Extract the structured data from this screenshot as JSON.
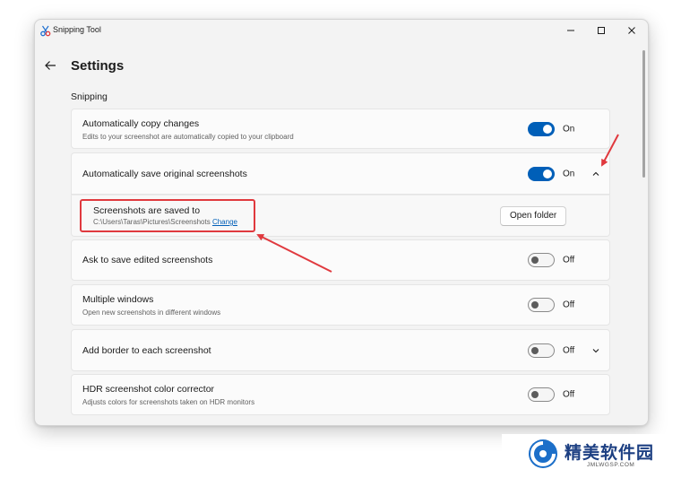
{
  "window": {
    "app_title": "Snipping Tool",
    "app_icon": "scissors-icon",
    "controls": {
      "minimize": "minimize-icon",
      "maximize": "maximize-icon",
      "close": "close-icon"
    }
  },
  "page": {
    "back_icon": "back-arrow-icon",
    "title": "Settings",
    "section": "Snipping"
  },
  "settings": {
    "auto_copy": {
      "title": "Automatically copy changes",
      "description": "Edits to your screenshot are automatically copied to your clipboard",
      "state": "On"
    },
    "auto_save": {
      "title": "Automatically save original screenshots",
      "state": "On",
      "expand_icon": "chevron-up-icon"
    },
    "save_location": {
      "title": "Screenshots are saved to",
      "path": "C:\\Users\\Taras\\Pictures\\Screenshots",
      "change_link": "Change",
      "button": "Open folder"
    },
    "ask_save": {
      "title": "Ask to save edited screenshots",
      "state": "Off"
    },
    "multi_window": {
      "title": "Multiple windows",
      "description": "Open new screenshots in different windows",
      "state": "Off"
    },
    "border": {
      "title": "Add border to each screenshot",
      "state": "Off",
      "expand_icon": "chevron-down-icon"
    },
    "hdr": {
      "title": "HDR screenshot color corrector",
      "description": "Adjusts colors for screenshots taken on HDR monitors",
      "state": "Off"
    }
  },
  "watermark": {
    "brand": "精美软件园",
    "url": "JMLWGSP.COM"
  },
  "colors": {
    "accent": "#005fb8",
    "annotation": "#e0393e",
    "background": "#f3f3f3",
    "card": "#fbfbfb",
    "watermark_text": "#1c3f82"
  }
}
